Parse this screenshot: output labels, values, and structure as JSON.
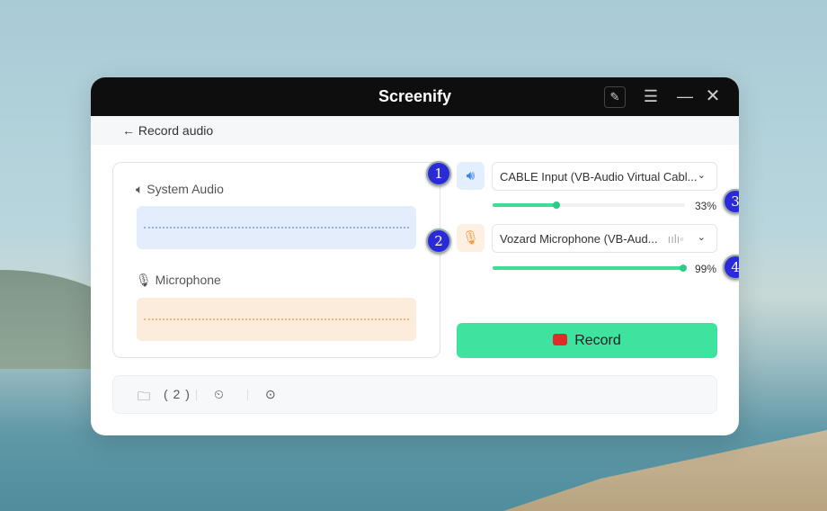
{
  "app": {
    "title": "Screenify"
  },
  "subheader": {
    "back_label": "← Record audio"
  },
  "left_panel": {
    "system_audio_label": "System Audio",
    "microphone_label": "Microphone"
  },
  "system_audio": {
    "device": "CABLE Input (VB-Audio Virtual Cabl...",
    "volume_percent": 33,
    "volume_label": "33%"
  },
  "microphone": {
    "device": "Vozard Microphone (VB-Aud...",
    "volume_percent": 99,
    "volume_label": "99%"
  },
  "record_button": {
    "label": "Record"
  },
  "footer": {
    "files_count": "( 2 )"
  },
  "badges": [
    "1",
    "2",
    "3",
    "4"
  ],
  "colors": {
    "accent": "#3de39f",
    "record": "#e02b2b",
    "badge": "#2a2ad8"
  }
}
